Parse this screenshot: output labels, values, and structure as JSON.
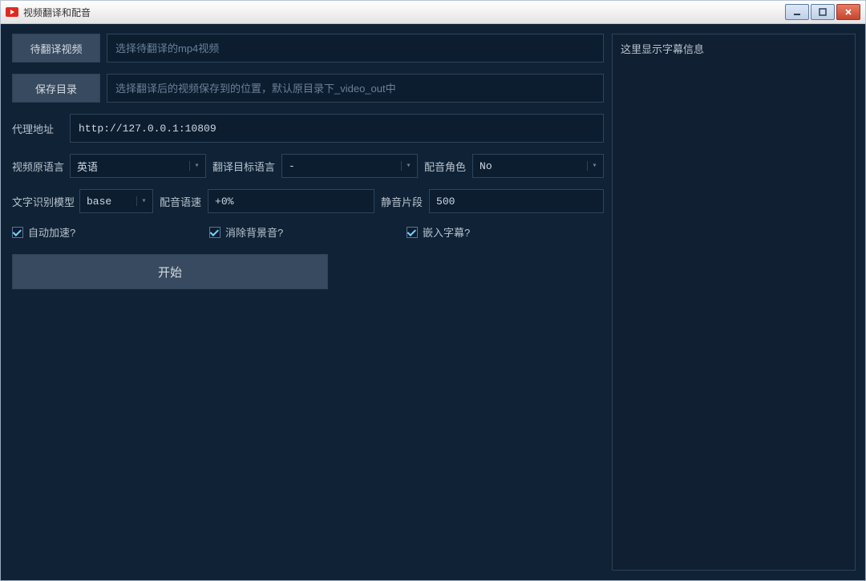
{
  "window": {
    "title": "视频翻译和配音"
  },
  "buttons": {
    "select_video": "待翻译视频",
    "select_save_dir": "保存目录",
    "start": "开始"
  },
  "inputs": {
    "video_placeholder": "选择待翻译的mp4视频",
    "video_value": "",
    "save_dir_placeholder": "选择翻译后的视频保存到的位置，默认原目录下_video_out中",
    "save_dir_value": "",
    "proxy_value": "http://127.0.0.1:10809",
    "speed_value": "+0%",
    "silence_value": "500"
  },
  "labels": {
    "proxy": "代理地址",
    "src_lang": "视频原语言",
    "target_lang": "翻译目标语言",
    "voice_role": "配音角色",
    "asr_model": "文字识别模型",
    "voice_speed": "配音语速",
    "silence": "静音片段"
  },
  "selects": {
    "src_lang": "英语",
    "target_lang": "-",
    "voice_role": "No",
    "asr_model": "base"
  },
  "checkboxes": {
    "auto_accel": "自动加速?",
    "remove_bg_audio": "消除背景音?",
    "embed_subtitle": "嵌入字幕?"
  },
  "right_panel": {
    "placeholder": "这里显示字幕信息"
  }
}
